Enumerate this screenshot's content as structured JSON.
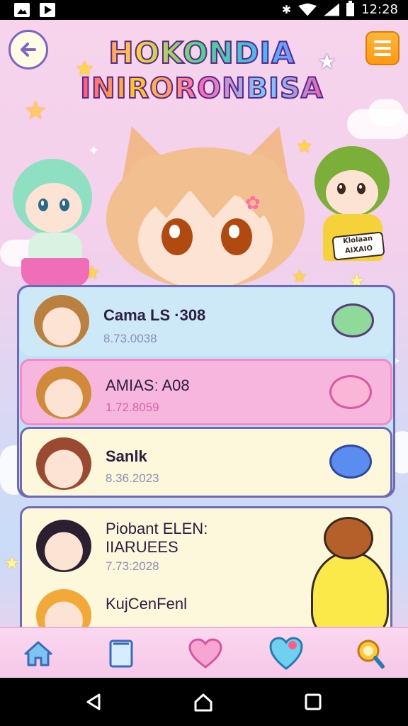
{
  "status_bar": {
    "time": "12:28",
    "icons": [
      "image-notification-icon",
      "play-store-icon",
      "bluetooth-icon",
      "wifi-icon",
      "signal-icon",
      "battery-icon"
    ]
  },
  "header": {
    "title_line1": "HOKONDIA",
    "title_line2": "INIRORONBISA",
    "back_icon": "arrow-left-icon",
    "menu_icon": "menu-icon"
  },
  "badge": {
    "text1": "Klolaan",
    "text2": "AIXAIO"
  },
  "list": {
    "items": [
      {
        "name": "Cama LS ·308",
        "date": "8.73.0038",
        "bg": "#cde9f8",
        "sticker_color": "#8fd99a"
      },
      {
        "name": "AMIASː A08",
        "date": "1.72.8059",
        "bg": "#f7b6de",
        "sticker_color": "#fbb5d6"
      },
      {
        "name": "Sanlk",
        "date": "8.36.2023",
        "bg": "#fdf8dc",
        "sticker_color": "#5b8cf0"
      },
      {
        "name": "Piobant ELEN:",
        "name2": "IIARUEES",
        "date": "7.73:2028",
        "bg": "#fdf8dc"
      },
      {
        "name": "KujCenFenl",
        "date": "",
        "bg": "#fdf8dc"
      }
    ]
  },
  "bottom_nav": {
    "items": [
      "home-icon",
      "book-icon",
      "heart-icon",
      "heart-icon",
      "search-icon"
    ]
  },
  "colors": {
    "accent": "#7a66c4",
    "menu": "#ff9914"
  }
}
